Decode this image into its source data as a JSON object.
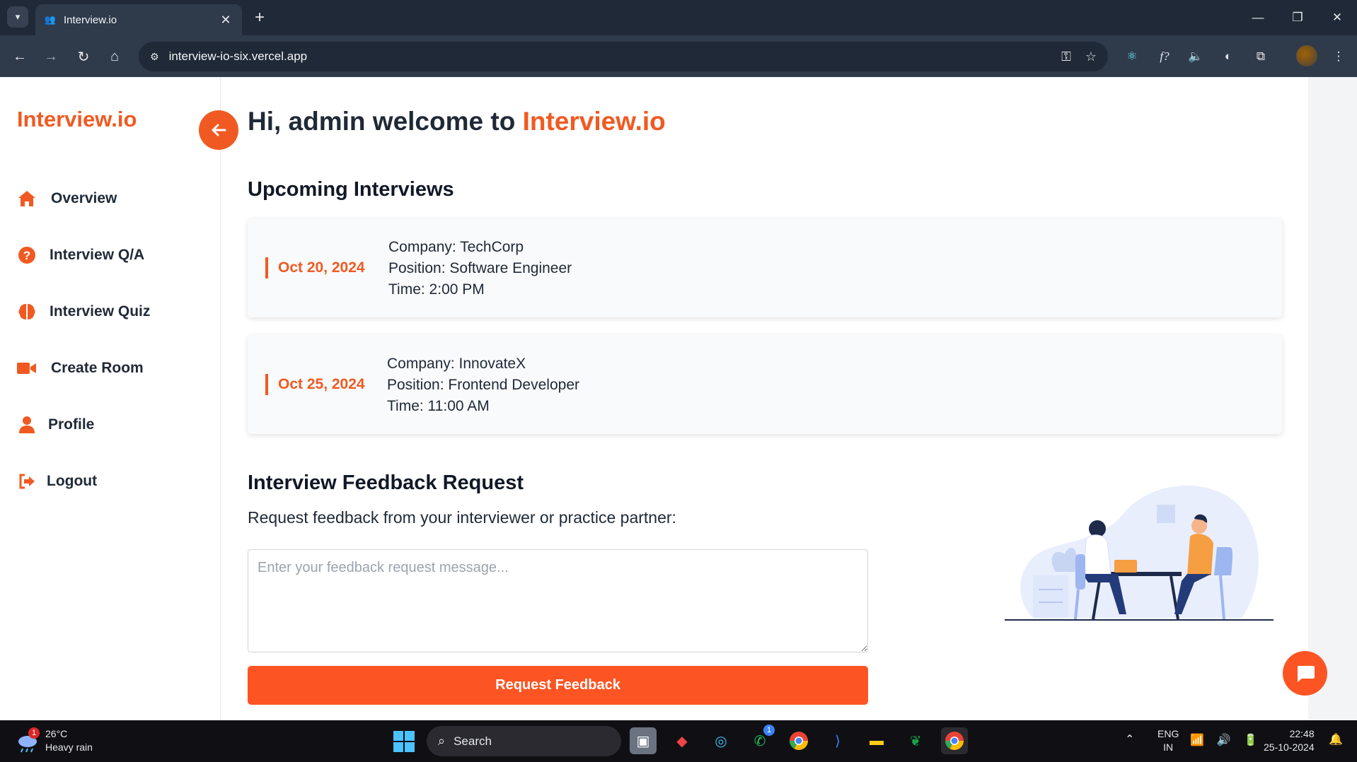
{
  "browser": {
    "tab_title": "Interview.io",
    "url": "interview-io-six.vercel.app"
  },
  "sidebar": {
    "brand": "Interview.io",
    "items": [
      {
        "label": "Overview",
        "icon": "home-icon"
      },
      {
        "label": "Interview Q/A",
        "icon": "question-icon"
      },
      {
        "label": "Interview Quiz",
        "icon": "brain-icon"
      },
      {
        "label": "Create Room",
        "icon": "video-icon"
      },
      {
        "label": "Profile",
        "icon": "user-icon"
      },
      {
        "label": "Logout",
        "icon": "logout-icon"
      }
    ]
  },
  "welcome": {
    "prefix": "Hi, admin welcome to",
    "brand": "Interview.io"
  },
  "upcoming": {
    "title": "Upcoming Interviews",
    "interviews": [
      {
        "date": "Oct 20, 2024",
        "company": "Company: TechCorp",
        "position": "Position: Software Engineer",
        "time": "Time: 2:00 PM"
      },
      {
        "date": "Oct 25, 2024",
        "company": "Company: InnovateX",
        "position": "Position: Frontend Developer",
        "time": "Time: 11:00 AM"
      }
    ]
  },
  "feedback": {
    "title": "Interview Feedback Request",
    "subtitle": "Request feedback from your interviewer or practice partner:",
    "placeholder": "Enter your feedback request message...",
    "button": "Request Feedback"
  },
  "taskbar": {
    "weather_temp": "26°C",
    "weather_desc": "Heavy rain",
    "weather_badge": "1",
    "search": "Search",
    "whatsapp_badge": "1",
    "lang_top": "ENG",
    "lang_bottom": "IN",
    "time": "22:48",
    "date": "25-10-2024"
  },
  "colors": {
    "accent": "#f05a22",
    "button": "#fc5523",
    "chrome_dark": "#1f2937"
  }
}
